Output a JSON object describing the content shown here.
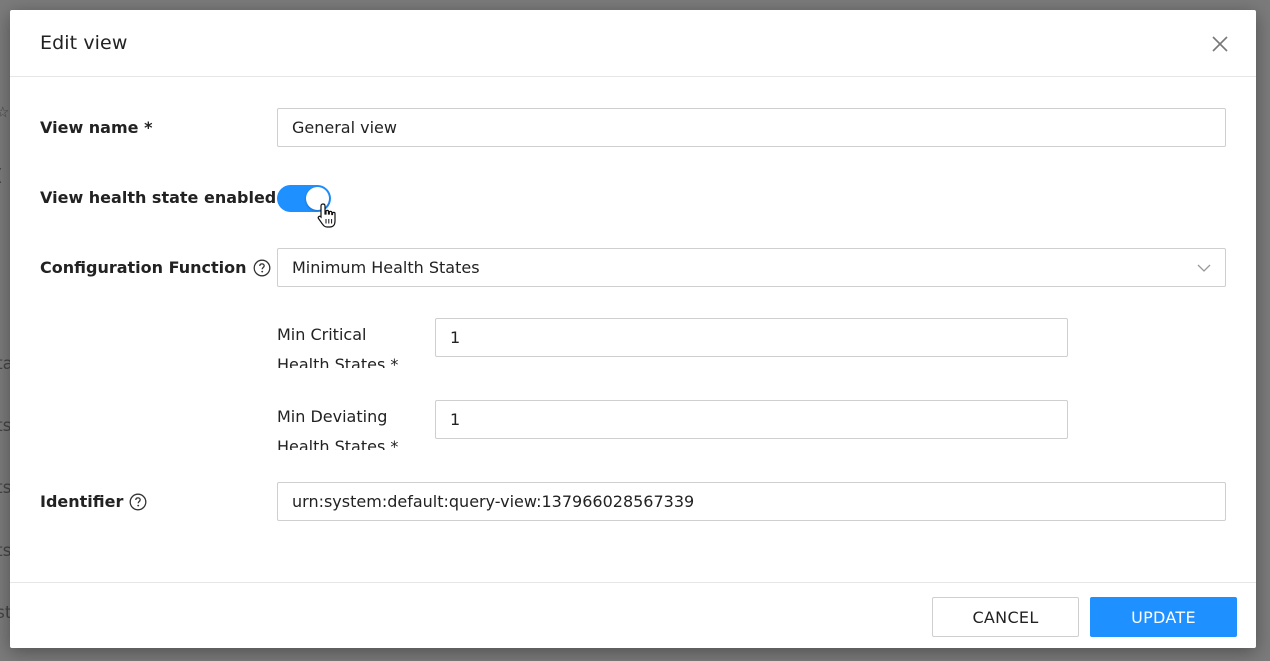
{
  "modal": {
    "title": "Edit view",
    "close_icon": "close-icon"
  },
  "form": {
    "view_name": {
      "label": "View name *",
      "value": "General view"
    },
    "health_state": {
      "label": "View health state enabled",
      "enabled": true
    },
    "configuration_function": {
      "label": "Configuration Function",
      "help_icon": "help-circle-icon",
      "selected": "Minimum Health States",
      "chevron_icon": "chevron-down-icon"
    },
    "min_critical": {
      "label_line1": "Min Critical",
      "label_line2": "Health States *",
      "value": "1"
    },
    "min_deviating": {
      "label_line1": "Min Deviating",
      "label_line2": "Health States *",
      "value": "1"
    },
    "identifier": {
      "label": "Identifier",
      "help_icon": "help-circle-icon",
      "value": "urn:system:default:query-view:137966028567339"
    }
  },
  "footer": {
    "cancel_label": "CANCEL",
    "update_label": "UPDATE"
  },
  "colors": {
    "accent": "#1e90ff",
    "overlay": "#7b7b7b"
  }
}
